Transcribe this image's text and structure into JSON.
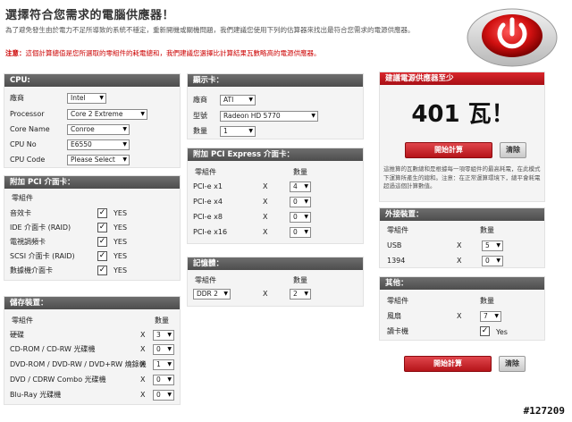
{
  "header": {
    "title": "選擇符合您需求的電腦供應器！",
    "intro": "為了避免發生由於電力不足所導致的系統不穩定，重新開機或關機問題，我們建議您使用下列的估算器來找出最符合您需求的電源供應器。",
    "note_label": "注意：",
    "note_text": "這個計算總值是您所選取的零組件的耗電總和，我們建議您選擇比計算結果瓦數略高的電源供應器。"
  },
  "cpu": {
    "title": "CPU:",
    "rows": [
      {
        "label": "廠商",
        "value": "Intel"
      },
      {
        "label": "Processor",
        "value": "Core 2 Extreme"
      },
      {
        "label": "Core Name",
        "value": "Conroe"
      },
      {
        "label": "CPU No",
        "value": "E6550"
      },
      {
        "label": "CPU Code",
        "value": "Please Select"
      }
    ]
  },
  "pci": {
    "title": "附加 PCI 介面卡：",
    "col_header": "零組件",
    "items": [
      {
        "label": "音效卡",
        "checked": true,
        "yes": "YES"
      },
      {
        "label": "IDE 介面卡 (RAID)",
        "checked": true,
        "yes": "YES"
      },
      {
        "label": "電視調頻卡",
        "checked": true,
        "yes": "YES"
      },
      {
        "label": "SCSI 介面卡 (RAID)",
        "checked": true,
        "yes": "YES"
      },
      {
        "label": "數據機介面卡",
        "checked": true,
        "yes": "YES"
      }
    ]
  },
  "storage": {
    "title": "儲存裝置：",
    "col_component": "零組件",
    "col_qty": "數量",
    "items": [
      {
        "label": "硬碟",
        "x": "X",
        "qty": "3"
      },
      {
        "label": "CD-ROM / CD-RW 光碟機",
        "x": "X",
        "qty": "0"
      },
      {
        "label": "DVD-ROM / DVD-RW / DVD+RW 燒錄機",
        "x": "X",
        "qty": "1"
      },
      {
        "label": "DVD / CDRW Combo 光碟機",
        "x": "X",
        "qty": "0"
      },
      {
        "label": "Blu-Ray 光碟機",
        "x": "X",
        "qty": "0"
      }
    ]
  },
  "gpu": {
    "title": "顯示卡：",
    "rows": [
      {
        "label": "廠商",
        "value": "ATI"
      },
      {
        "label": "型號",
        "value": "Radeon HD 5770"
      },
      {
        "label": "數量",
        "value": "1"
      }
    ]
  },
  "pcie": {
    "title": "附加 PCI Express 介面卡：",
    "col_component": "零組件",
    "col_qty": "數量",
    "items": [
      {
        "label": "PCI-e x1",
        "x": "X",
        "qty": "4"
      },
      {
        "label": "PCI-e x4",
        "x": "X",
        "qty": "0"
      },
      {
        "label": "PCI-e x8",
        "x": "X",
        "qty": "0"
      },
      {
        "label": "PCI-e x16",
        "x": "X",
        "qty": "0"
      }
    ]
  },
  "memory": {
    "title": "記憶體：",
    "col_component": "零組件",
    "col_qty": "數量",
    "type": "DDR 2",
    "x": "X",
    "qty": "2"
  },
  "result": {
    "title": "建議電源供應器至少",
    "watts": "401 瓦！",
    "calc_button": "開始計算",
    "clear_button": "清除",
    "description": "這推算的瓦數總和是根據每一項零組件的最高耗電，在此模式下運算所產生的總和。注意：在正常運算環境下，總平會耗電超過這個計算數值。"
  },
  "external": {
    "title": "外接裝置：",
    "col_component": "零組件",
    "col_qty": "數量",
    "items": [
      {
        "label": "USB",
        "x": "X",
        "qty": "5"
      },
      {
        "label": "1394",
        "x": "X",
        "qty": "0"
      }
    ]
  },
  "other": {
    "title": "其他：",
    "col_component": "零組件",
    "col_qty": "數量",
    "fan_label": "風扇",
    "fan_x": "X",
    "fan_qty": "7",
    "reader_label": "讀卡機",
    "reader_checked": true,
    "reader_yes": "Yes"
  },
  "bottom_buttons": {
    "calc": "開始計算",
    "clear": "清除"
  },
  "watermark": "#127209",
  "colors": {
    "accent_red": "#c0141a",
    "panel_header": "#5a5a5a",
    "panel_bg": "#f4f4f4"
  }
}
